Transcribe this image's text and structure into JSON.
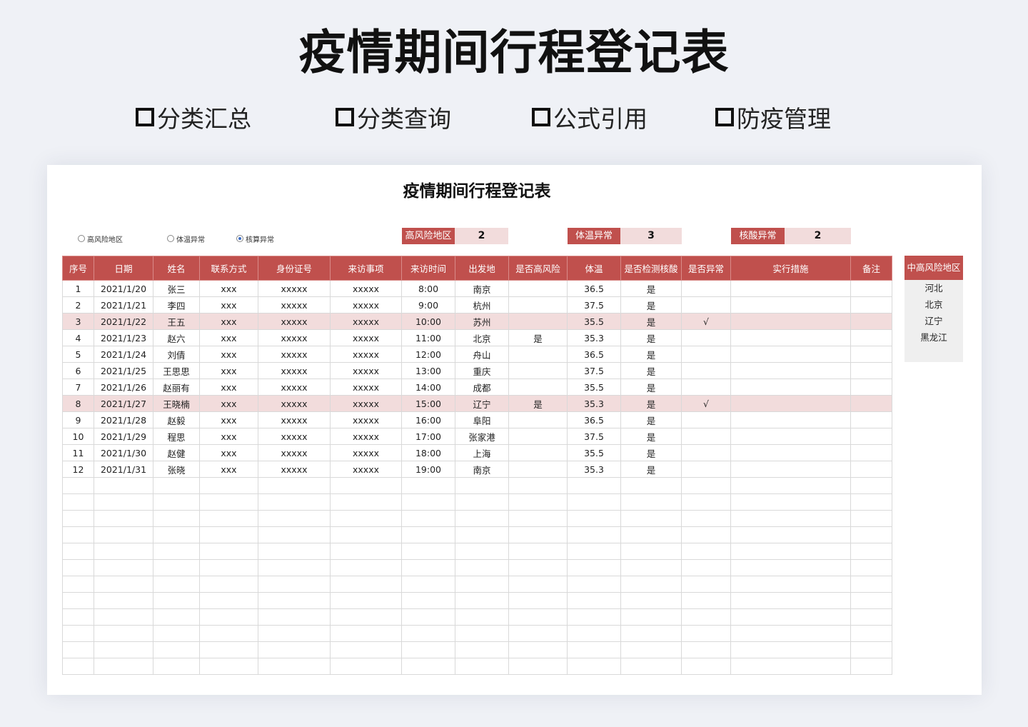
{
  "header": {
    "title": "疫情期间行程登记表",
    "features": [
      "分类汇总",
      "分类查询",
      "公式引用",
      "防疫管理"
    ]
  },
  "sheet": {
    "title": "疫情期间行程登记表",
    "radios": [
      {
        "label": "高风险地区",
        "checked": false
      },
      {
        "label": "体温异常",
        "checked": false
      },
      {
        "label": "核算异常",
        "checked": true
      }
    ],
    "stats": [
      {
        "label": "高风险地区",
        "value": "2"
      },
      {
        "label": "体温异常",
        "value": "3"
      },
      {
        "label": "核酸异常",
        "value": "2"
      }
    ],
    "columns": [
      "序号",
      "日期",
      "姓名",
      "联系方式",
      "身份证号",
      "来访事项",
      "来访时间",
      "出发地",
      "是否高风险",
      "体温",
      "是否检测核酸",
      "是否异常",
      "实行措施",
      "备注"
    ],
    "rows": [
      [
        "1",
        "2021/1/20",
        "张三",
        "xxx",
        "xxxxx",
        "xxxxx",
        "8:00",
        "南京",
        "",
        "36.5",
        "是",
        "",
        "",
        ""
      ],
      [
        "2",
        "2021/1/21",
        "李四",
        "xxx",
        "xxxxx",
        "xxxxx",
        "9:00",
        "杭州",
        "",
        "37.5",
        "是",
        "",
        "",
        ""
      ],
      [
        "3",
        "2021/1/22",
        "王五",
        "xxx",
        "xxxxx",
        "xxxxx",
        "10:00",
        "苏州",
        "",
        "35.5",
        "是",
        "√",
        "",
        ""
      ],
      [
        "4",
        "2021/1/23",
        "赵六",
        "xxx",
        "xxxxx",
        "xxxxx",
        "11:00",
        "北京",
        "是",
        "35.3",
        "是",
        "",
        "",
        ""
      ],
      [
        "5",
        "2021/1/24",
        "刘倩",
        "xxx",
        "xxxxx",
        "xxxxx",
        "12:00",
        "舟山",
        "",
        "36.5",
        "是",
        "",
        "",
        ""
      ],
      [
        "6",
        "2021/1/25",
        "王思思",
        "xxx",
        "xxxxx",
        "xxxxx",
        "13:00",
        "重庆",
        "",
        "37.5",
        "是",
        "",
        "",
        ""
      ],
      [
        "7",
        "2021/1/26",
        "赵丽有",
        "xxx",
        "xxxxx",
        "xxxxx",
        "14:00",
        "成都",
        "",
        "35.5",
        "是",
        "",
        "",
        ""
      ],
      [
        "8",
        "2021/1/27",
        "王晓楠",
        "xxx",
        "xxxxx",
        "xxxxx",
        "15:00",
        "辽宁",
        "是",
        "35.3",
        "是",
        "√",
        "",
        ""
      ],
      [
        "9",
        "2021/1/28",
        "赵毅",
        "xxx",
        "xxxxx",
        "xxxxx",
        "16:00",
        "阜阳",
        "",
        "36.5",
        "是",
        "",
        "",
        ""
      ],
      [
        "10",
        "2021/1/29",
        "程思",
        "xxx",
        "xxxxx",
        "xxxxx",
        "17:00",
        "张家港",
        "",
        "37.5",
        "是",
        "",
        "",
        ""
      ],
      [
        "11",
        "2021/1/30",
        "赵健",
        "xxx",
        "xxxxx",
        "xxxxx",
        "18:00",
        "上海",
        "",
        "35.5",
        "是",
        "",
        "",
        ""
      ],
      [
        "12",
        "2021/1/31",
        "张晓",
        "xxx",
        "xxxxx",
        "xxxxx",
        "19:00",
        "南京",
        "",
        "35.3",
        "是",
        "",
        "",
        ""
      ]
    ],
    "highlighted_rows": [
      3,
      8
    ],
    "empty_row_count": 12,
    "side_panel": {
      "title": "中高风险地区",
      "items": [
        "河北",
        "北京",
        "辽宁",
        "黑龙江"
      ]
    },
    "colors": {
      "header_red": "#c0504d",
      "highlight_pink": "#f2dcdc",
      "background": "#eff1f6"
    }
  }
}
